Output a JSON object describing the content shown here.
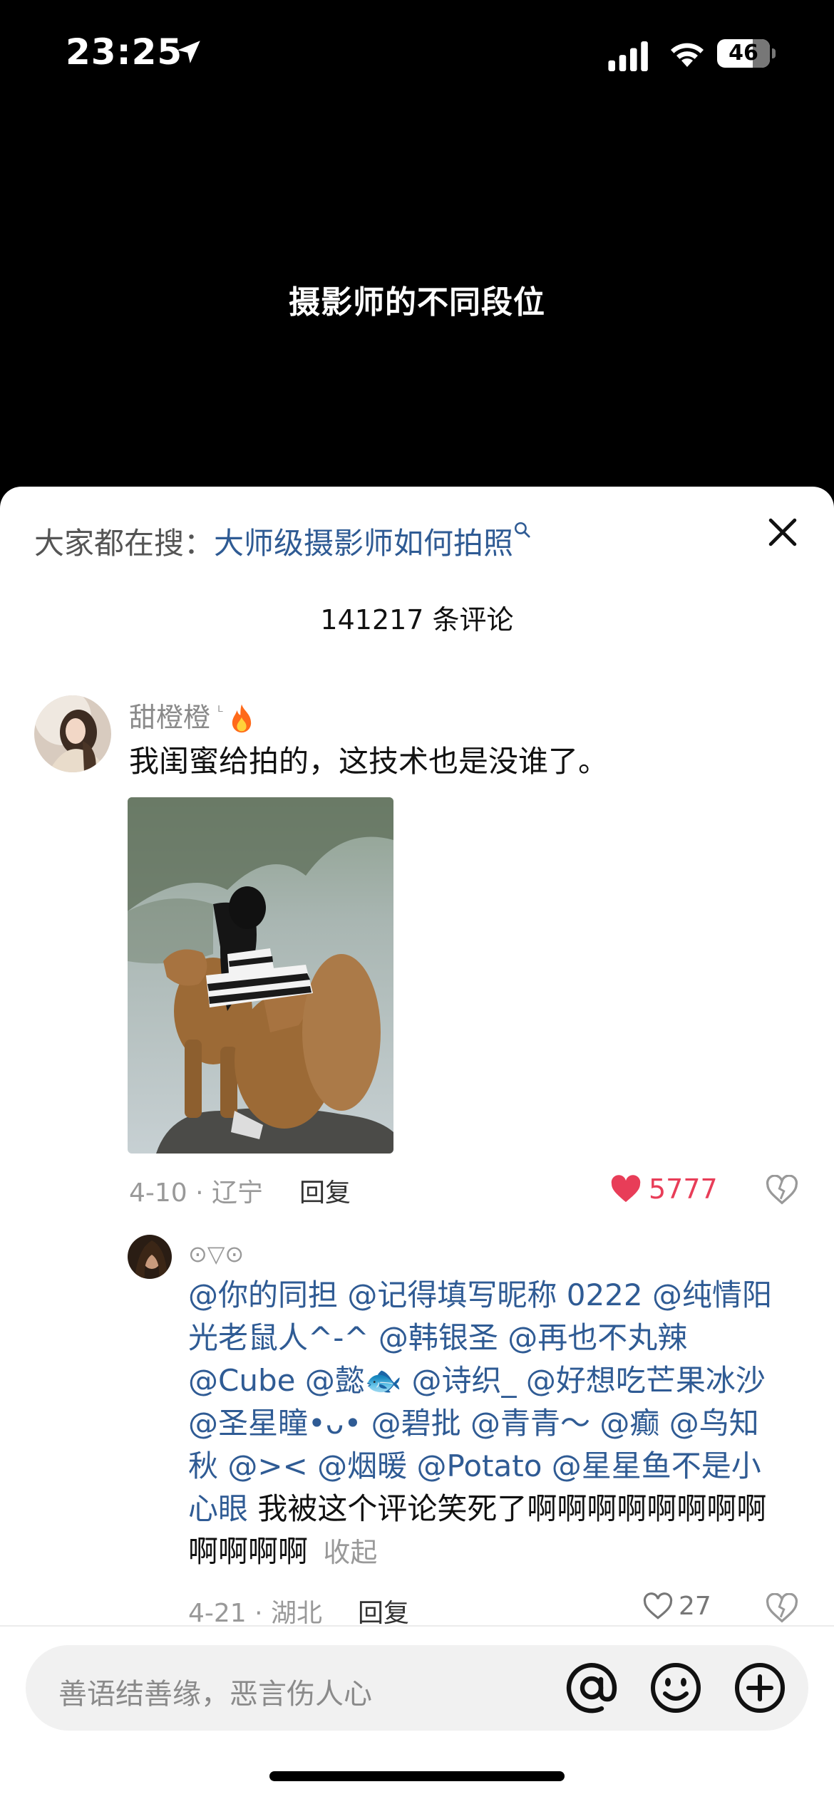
{
  "status_bar": {
    "time": "23:25",
    "battery": "46",
    "icons": [
      "location-arrow-icon",
      "signal-icon",
      "wifi-icon",
      "battery-icon"
    ]
  },
  "video": {
    "caption": "摄影师的不同段位"
  },
  "comments_sheet": {
    "search_prefix": "大家都在搜：",
    "search_query": "大师级摄影师如何拍照",
    "close_icon": "close-icon",
    "count_text": "141217 条评论"
  },
  "top_comment": {
    "username": "甜橙橙",
    "username_mark": "ᴸ",
    "badge_icon": "fire-icon",
    "text": "我闺蜜给拍的，这技术也是没谁了。",
    "date_location": "4-10 · 辽宁",
    "reply_label": "回复",
    "likes": "5777",
    "liked": true,
    "accent_color": "#e83d58"
  },
  "reply_comment": {
    "username": "⊙▽⊙",
    "mentions": [
      "@你的同担",
      "@记得填写昵称 0222",
      "@纯情阳光老鼠人^-^",
      "@韩银圣",
      "@再也不丸辣",
      "@Cube",
      "@懿🐟",
      "@诗织_",
      "@好想吃芒果冰沙",
      "@圣星瞳•ᴗ•",
      "@碧批",
      "@青青～",
      "@癫",
      "@鸟知秋",
      "@><",
      "@烟暖",
      "@Potato",
      "@星星鱼不是小心眼"
    ],
    "text": "我被这个评论笑死了啊啊啊啊啊啊啊啊啊啊啊啊",
    "collapse_label": "收起",
    "date_location": "4-21 · 湖北",
    "reply_label": "回复",
    "likes": "27",
    "mention_color": "#2f5b94"
  },
  "input_bar": {
    "placeholder": "善语结善缘，恶言伤人心",
    "buttons": [
      "at-icon",
      "emoji-icon",
      "plus-icon"
    ]
  }
}
